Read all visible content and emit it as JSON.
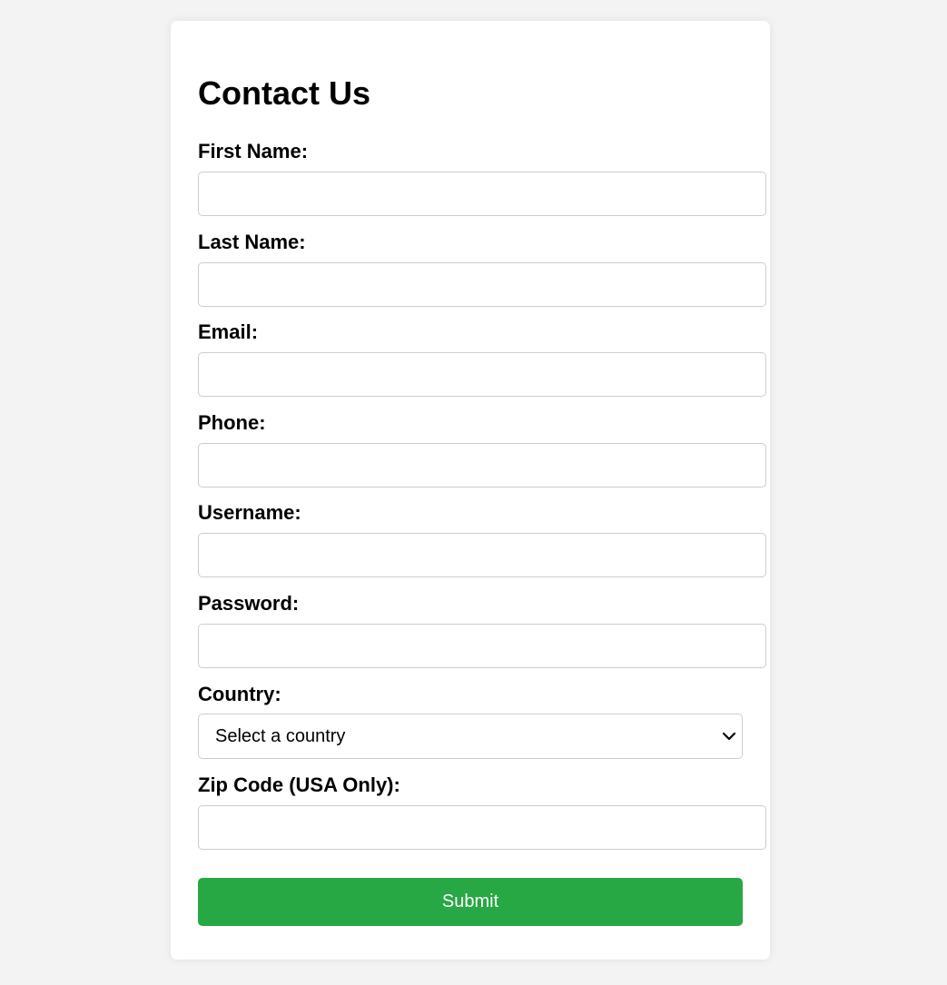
{
  "form": {
    "title": "Contact Us",
    "fields": [
      {
        "label": "First Name:",
        "value": "",
        "placeholder": ""
      },
      {
        "label": "Last Name:",
        "value": "",
        "placeholder": ""
      },
      {
        "label": "Email:",
        "value": "",
        "placeholder": ""
      },
      {
        "label": "Phone:",
        "value": "",
        "placeholder": ""
      },
      {
        "label": "Username:",
        "value": "",
        "placeholder": ""
      },
      {
        "label": "Password:",
        "value": "",
        "placeholder": ""
      }
    ],
    "country": {
      "label": "Country:",
      "selected": "Select a country",
      "icon": "chevron-down-icon"
    },
    "zip": {
      "label": "Zip Code (USA Only):",
      "value": "",
      "placeholder": ""
    },
    "submit_label": "Submit"
  },
  "colors": {
    "page_background": "#f3f3f3",
    "card_background": "#ffffff",
    "submit_button": "#28a745",
    "input_border": "#cccccc"
  }
}
